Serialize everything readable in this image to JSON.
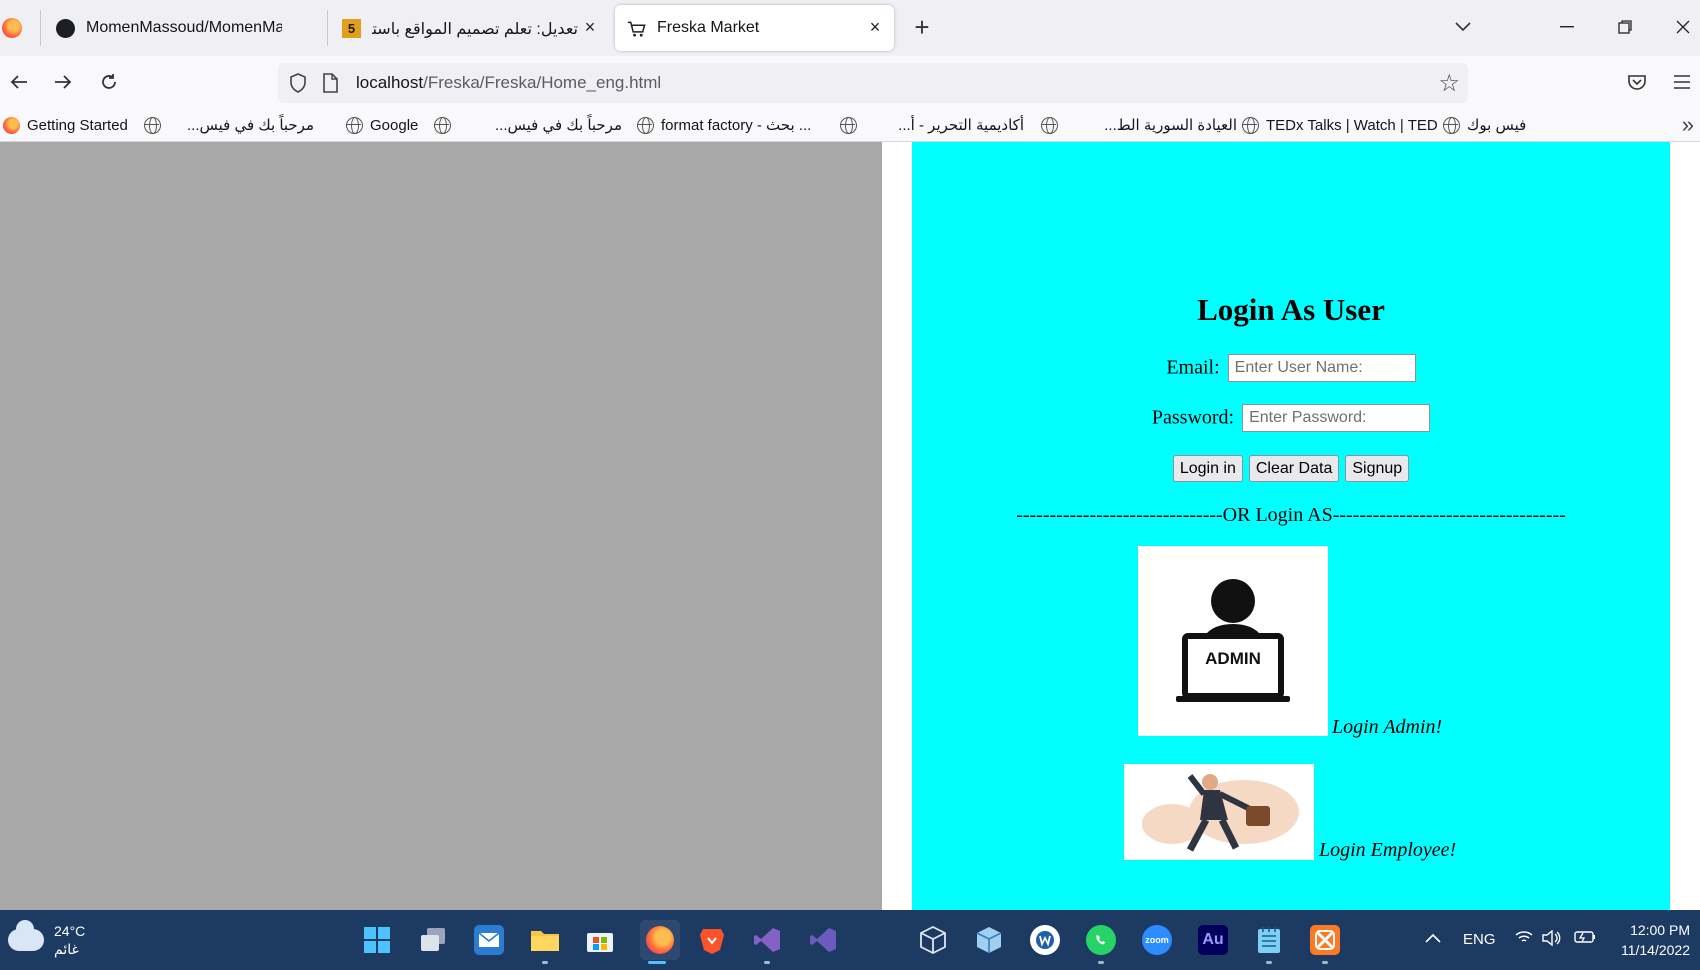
{
  "browser": {
    "tabs": [
      {
        "title": "MomenMassoud/MomenMassoud",
        "icon": "github-icon",
        "active": false
      },
      {
        "title": "تعديل: تعلم تصميم المواقع باستخدام",
        "icon": "html5-icon",
        "icon_text": "5",
        "active": false
      },
      {
        "title": "Freska Market",
        "icon": "shopping-cart-icon",
        "active": true
      }
    ],
    "close_glyph": "×",
    "new_tab_glyph": "+",
    "url": {
      "host": "localhost",
      "path": "/Freska/Freska/Home_eng.html"
    }
  },
  "bookmarks": [
    {
      "label": "Getting Started",
      "icon": "firefox-icon"
    },
    {
      "label": "مرحباً بك في فيس...",
      "icon": "globe-icon"
    },
    {
      "label": "Google",
      "icon": "globe-icon"
    },
    {
      "label": "مرحباً بك في فيس...",
      "icon": "globe-icon"
    },
    {
      "label": "format factory - بحث ...",
      "icon": "globe-icon"
    },
    {
      "label": "أكاديمية التحرير - أ...",
      "icon": "globe-icon"
    },
    {
      "label": "العيادة السورية الط...",
      "icon": "globe-icon"
    },
    {
      "label": "TEDx Talks | Watch | TED",
      "icon": "globe-icon"
    },
    {
      "label": "فيس بوك",
      "icon": "globe-icon"
    }
  ],
  "page": {
    "title": "Login As User",
    "email_label": "Email:",
    "email_placeholder": "Enter User Name:",
    "password_label": "Password:",
    "password_placeholder": "Enter Password:",
    "login_button": "Login in",
    "clear_button": "Clear Data",
    "signup_button": "Signup",
    "or_line": "-------------------------------OR Login AS-----------------------------------",
    "admin_image_text": "ADMIN",
    "admin_link": "Login Admin!",
    "employee_link": "Login Employee!",
    "colors": {
      "panel": "#00ffff",
      "left_pane": "#a8a8a8"
    }
  },
  "taskbar": {
    "weather_temp": "24°C",
    "weather_desc": "غائم",
    "lang": "ENG",
    "time": "12:00 PM",
    "date": "11/14/2022",
    "apps": [
      "windows-start-icon",
      "task-view-icon",
      "mail-icon",
      "file-explorer-icon",
      "microsoft-store-icon",
      "firefox-icon",
      "brave-icon",
      "visual-studio-icon",
      "cube-icon",
      "virtualbox-icon",
      "wps-icon",
      "whatsapp-icon",
      "zoom-icon",
      "audition-icon",
      "notepad-icon",
      "xampp-icon"
    ],
    "audition_label": "Au",
    "zoom_label": "zoom"
  }
}
